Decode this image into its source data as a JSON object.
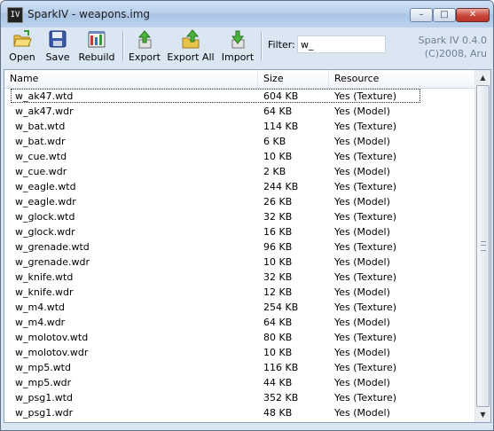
{
  "window": {
    "title": "SparkIV - weapons.img",
    "icon_text": "IV",
    "minimize_glyph": "–",
    "maximize_glyph": "□",
    "close_glyph": "✕"
  },
  "toolbar": {
    "open_label": "Open",
    "save_label": "Save",
    "rebuild_label": "Rebuild",
    "export_label": "Export",
    "export_all_label": "Export All",
    "import_label": "Import",
    "filter_label": "Filter:",
    "filter_value": "w_"
  },
  "brand": {
    "line1": "Spark IV 0.4.0",
    "line2": "(C)2008, Aru"
  },
  "list": {
    "columns": {
      "name": "Name",
      "size": "Size",
      "resource": "Resource"
    },
    "rows": [
      [
        "w_ak47.wtd",
        "604 KB",
        "Yes (Texture)"
      ],
      [
        "w_ak47.wdr",
        "64 KB",
        "Yes (Model)"
      ],
      [
        "w_bat.wtd",
        "114 KB",
        "Yes (Texture)"
      ],
      [
        "w_bat.wdr",
        "6 KB",
        "Yes (Model)"
      ],
      [
        "w_cue.wtd",
        "10 KB",
        "Yes (Texture)"
      ],
      [
        "w_cue.wdr",
        "2 KB",
        "Yes (Model)"
      ],
      [
        "w_eagle.wtd",
        "244 KB",
        "Yes (Texture)"
      ],
      [
        "w_eagle.wdr",
        "26 KB",
        "Yes (Model)"
      ],
      [
        "w_glock.wtd",
        "32 KB",
        "Yes (Texture)"
      ],
      [
        "w_glock.wdr",
        "16 KB",
        "Yes (Model)"
      ],
      [
        "w_grenade.wtd",
        "96 KB",
        "Yes (Texture)"
      ],
      [
        "w_grenade.wdr",
        "10 KB",
        "Yes (Model)"
      ],
      [
        "w_knife.wtd",
        "32 KB",
        "Yes (Texture)"
      ],
      [
        "w_knife.wdr",
        "12 KB",
        "Yes (Model)"
      ],
      [
        "w_m4.wtd",
        "254 KB",
        "Yes (Texture)"
      ],
      [
        "w_m4.wdr",
        "64 KB",
        "Yes (Model)"
      ],
      [
        "w_molotov.wtd",
        "80 KB",
        "Yes (Texture)"
      ],
      [
        "w_molotov.wdr",
        "10 KB",
        "Yes (Model)"
      ],
      [
        "w_mp5.wtd",
        "116 KB",
        "Yes (Texture)"
      ],
      [
        "w_mp5.wdr",
        "44 KB",
        "Yes (Model)"
      ],
      [
        "w_psg1.wtd",
        "352 KB",
        "Yes (Texture)"
      ],
      [
        "w_psg1.wdr",
        "48 KB",
        "Yes (Model)"
      ]
    ]
  },
  "scrollbar": {
    "up_glyph": "▲",
    "down_glyph": "▼"
  }
}
